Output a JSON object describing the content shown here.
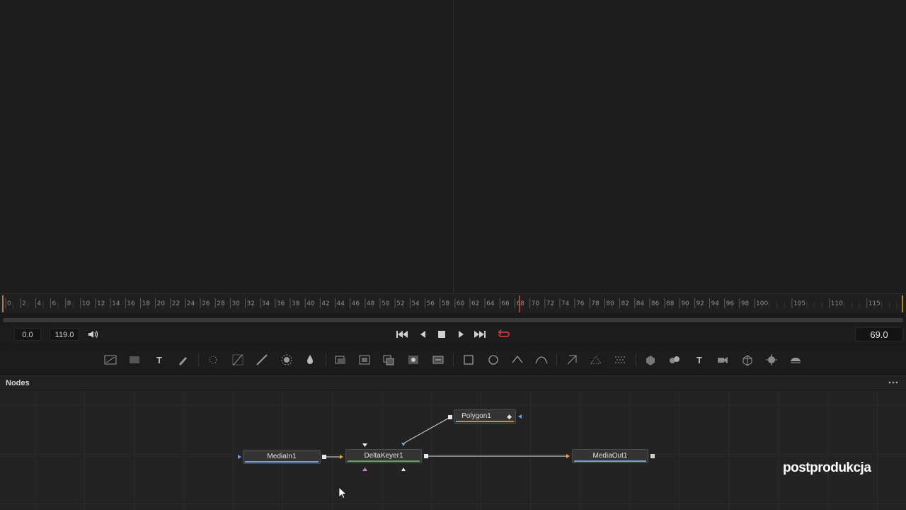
{
  "ruler": {
    "small_ticks": [
      "0",
      "2",
      "4",
      "6",
      "8",
      "10",
      "12",
      "14",
      "16",
      "18",
      "20",
      "22",
      "24",
      "26",
      "28",
      "30",
      "32",
      "34",
      "36",
      "38",
      "40",
      "42",
      "44",
      "46",
      "48",
      "50",
      "52",
      "54",
      "56",
      "58",
      "60",
      "62",
      "64",
      "66",
      "68",
      "70",
      "72",
      "74",
      "76",
      "78",
      "80",
      "82",
      "84",
      "86",
      "88",
      "90",
      "92",
      "94",
      "96",
      "98",
      "100"
    ],
    "large_ticks": [
      "105",
      "110",
      "115"
    ],
    "playhead_frame": 69
  },
  "transport": {
    "render_start": "0.0",
    "render_end": "119.0",
    "current_time": "69.0"
  },
  "toolbar": {
    "tools": [
      {
        "icon": "background-icon"
      },
      {
        "icon": "paint-image-icon"
      },
      {
        "icon": "text-icon",
        "glyph": "T"
      },
      {
        "icon": "paint-brush-icon"
      },
      {
        "icon": "particles-icon"
      },
      {
        "icon": "color-curves-icon"
      },
      {
        "icon": "color-corrector-icon"
      },
      {
        "icon": "brightness-contrast-icon"
      },
      {
        "icon": "blur-drop-icon"
      },
      {
        "icon": "merge-icon"
      },
      {
        "icon": "channel-booleans-icon"
      },
      {
        "icon": "matte-control-icon"
      },
      {
        "icon": "ultra-keyer-icon"
      },
      {
        "icon": "transform-icon"
      },
      {
        "icon": "rectangle-mask-icon"
      },
      {
        "icon": "ellipse-mask-icon"
      },
      {
        "icon": "polygon-mask-icon"
      },
      {
        "icon": "bspline-mask-icon"
      },
      {
        "icon": "tracker-icon"
      },
      {
        "icon": "planar-tracker-icon"
      },
      {
        "icon": "particle-emitter-icon"
      },
      {
        "icon": "shape-3d-icon"
      },
      {
        "icon": "merge-3d-icon"
      },
      {
        "icon": "text-3d-icon",
        "glyph": "T"
      },
      {
        "icon": "camera-3d-icon"
      },
      {
        "icon": "renderer-3d-icon"
      },
      {
        "icon": "light-3d-icon"
      },
      {
        "icon": "fog-3d-icon"
      }
    ]
  },
  "nodes_panel": {
    "title": "Nodes",
    "nodes": {
      "media_in": {
        "label": "MediaIn1"
      },
      "delta_keyer": {
        "label": "DeltaKeyer1"
      },
      "polygon": {
        "label": "Polygon1"
      },
      "media_out": {
        "label": "MediaOut1"
      }
    }
  },
  "watermark": {
    "text": "postprodukcja"
  },
  "colors": {
    "accent_orange": "#e3a33b",
    "playhead_red": "#d04a3a",
    "loop_red": "#e0443a",
    "media_line_blue": "#6fa0d8",
    "keyer_line_green": "#5fa05f",
    "polygon_line_orange": "#d08a3a"
  }
}
